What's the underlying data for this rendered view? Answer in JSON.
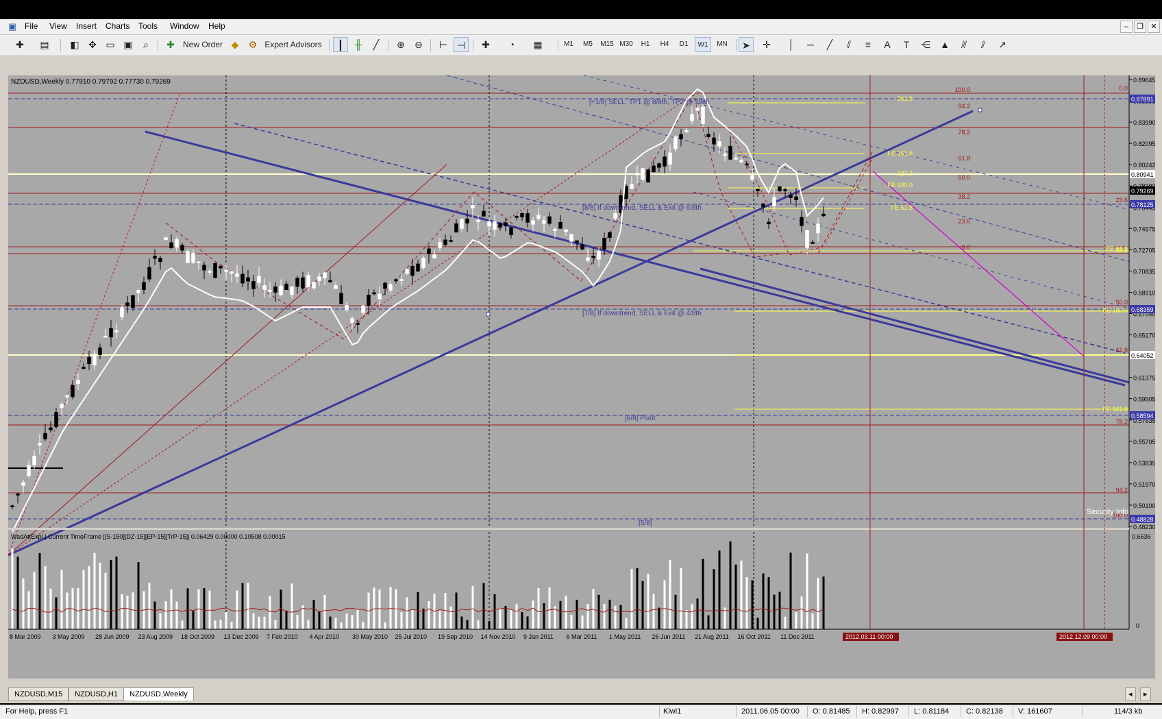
{
  "menu": {
    "items": [
      "File",
      "View",
      "Insert",
      "Charts",
      "Tools",
      "Window",
      "Help"
    ]
  },
  "toolbar": {
    "new_order_label": "New Order",
    "expert_advisors_label": "Expert Advisors",
    "timeframes": [
      "M1",
      "M5",
      "M15",
      "M30",
      "H1",
      "H4",
      "D1",
      "W1",
      "MN"
    ],
    "selected_timeframe": "W1",
    "text_tool_label": "A"
  },
  "chart": {
    "info_label": "NZDUSD,Weekly  0.77910 0.79792 0.77730 0.79269",
    "price_scale": [
      "0.89645",
      "0.85895",
      "0.83990",
      "0.82095",
      "0.80242",
      "0.78380",
      "0.76445",
      "0.74575",
      "0.72705",
      "0.70835",
      "0.68910",
      "0.67040",
      "0.65170",
      "0.63300",
      "0.61375",
      "0.59505",
      "0.57635",
      "0.55705",
      "0.53835",
      "0.51970",
      "0.50100",
      "0.48230"
    ],
    "price_tags": [
      {
        "text": "0.87891",
        "color": "#3a3aa8"
      },
      {
        "text": "0.80941",
        "color": "#ffffff"
      },
      {
        "text": "0.79269",
        "color": "#000000"
      },
      {
        "text": "0.78125",
        "color": "#3a3aa8"
      },
      {
        "text": "0.68359",
        "color": "#3a3aa8"
      },
      {
        "text": "0.64052",
        "color": "#ffffff"
      },
      {
        "text": "0.58594",
        "color": "#3a3aa8"
      },
      {
        "text": "0.48828",
        "color": "#3a3aa8"
      }
    ],
    "time_scale": [
      "8 Mar 2009",
      "3 May 2009",
      "28 Jun 2009",
      "23 Aug 2009",
      "18 Oct 2009",
      "13 Dec 2009",
      "7 Feb 2010",
      "4 Apr 2010",
      "30 May 2010",
      "25 Jul 2010",
      "19 Sep 2010",
      "14 Nov 2010",
      "9 Jan 2011",
      "6 Mar 2011",
      "1 May 2011",
      "26 Jun 2011",
      "21 Aug 2011",
      "16 Oct 2011",
      "11 Dec 2011"
    ],
    "time_markers": [
      "2012.03.11 00:00",
      "2012.12.09 00:00"
    ],
    "annotations": [
      "[+1/8] SELL: TP1 @ 8/8th, TP2 @ 7/8th",
      "[8/8] If downtrend, SELL & Exit @ 6/8th",
      "[7/8] If downtrend, SELL & Exit @ 4/8th",
      "[6/8] Pivot",
      "[5/8]"
    ],
    "fib_levels_red": [
      "100.0",
      "94.2",
      "78.2",
      "61.8",
      "50.0",
      "38.2",
      "23.6",
      "0.0"
    ],
    "fib_levels_right": [
      "0.0",
      "23.6",
      "50.0",
      "61.8",
      "78.2",
      "94.2",
      "100.0"
    ],
    "fe_levels_yellow": [
      "261.8",
      "FE 161.8",
      "127.2",
      "FE 100.0",
      "FE 61.8",
      "FE 61.8",
      "38.2",
      "FE 100.0",
      "FE 161.8"
    ],
    "watermark": "Security Infoframes",
    "indicator_label": "WadAttExpl | Current TimeFrame |[S-150][DZ-15][EP-15][TrP-15]| 0.06429 0.00000 0.10508 0.00015",
    "indicator_scale_top": "0.6636",
    "indicator_scale_bottom": "0"
  },
  "tabs": [
    "NZDUSD,M15",
    "NZDUSD,H1",
    "NZDUSD,Weekly"
  ],
  "active_tab": "NZDUSD,Weekly",
  "status": {
    "help": "For Help, press F1",
    "profile": "Kiwi1",
    "datetime": "2011.06.05 00:00",
    "open": "O: 0.81485",
    "high": "H: 0.82997",
    "low": "L: 0.81184",
    "close": "C: 0.82138",
    "volume": "V: 161607",
    "traffic": "114/3 kb"
  }
}
